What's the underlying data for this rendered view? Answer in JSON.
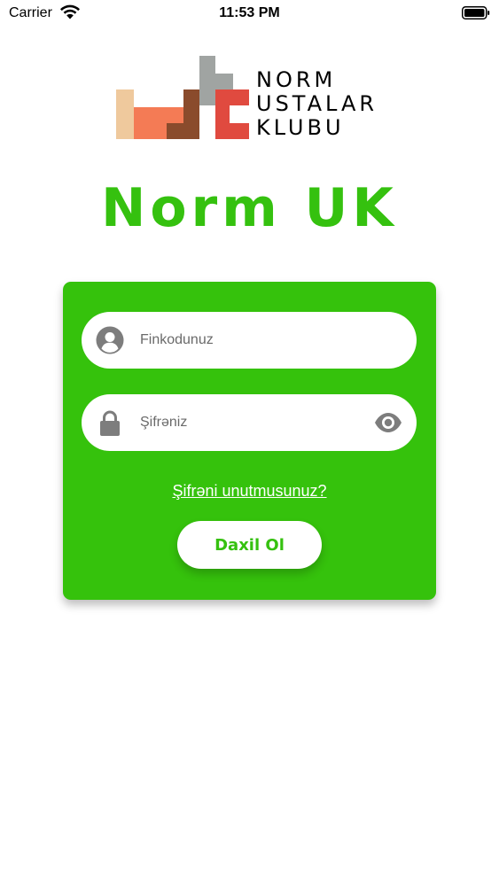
{
  "status_bar": {
    "carrier": "Carrier",
    "time": "11:53 PM",
    "wifi_icon": "wifi-icon",
    "battery_icon": "battery-icon"
  },
  "logo": {
    "lines": [
      "NORM",
      "USTALAR",
      "KLUBU"
    ]
  },
  "brand_title": "Norm UK",
  "login_card": {
    "username": {
      "placeholder": "Finkodunuz",
      "value": "",
      "icon": "user-icon"
    },
    "password": {
      "placeholder": "Şifrəniz",
      "value": "",
      "icon": "lock-icon",
      "toggle_icon": "eye-icon"
    },
    "forgot_password_label": "Şifrəni unutmusunuz?",
    "login_button_label": "Daxil Ol"
  },
  "colors": {
    "accent_green": "#35c20c",
    "white": "#ffffff",
    "icon_gray": "#7d7d7d"
  }
}
